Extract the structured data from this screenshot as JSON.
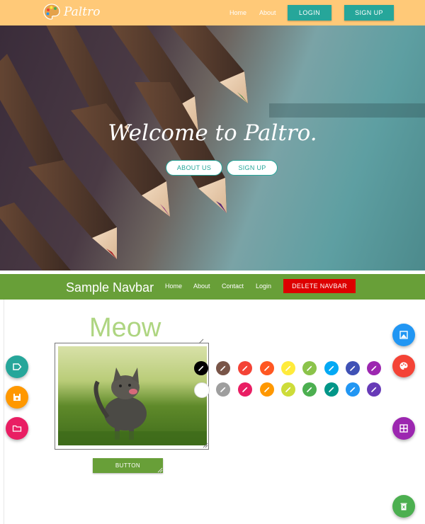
{
  "topbar": {
    "logo_text": "Paltro",
    "links": [
      "Home",
      "About"
    ],
    "login_label": "LOGIN",
    "signup_label": "SIGN UP"
  },
  "hero": {
    "title": "Welcome to Paltro.",
    "about_label": "ABOUT US",
    "signup_label": "SIGN UP"
  },
  "navbar": {
    "brand": "Sample Navbar",
    "links": [
      "Home",
      "About",
      "Contact",
      "Login"
    ],
    "delete_label": "DELETE NAVBAR"
  },
  "canvas": {
    "heading": "Meow",
    "button_label": "BUTTON"
  },
  "palette": {
    "row1": [
      "#000000",
      "#795548",
      "#F44336",
      "#FF5722",
      "#FFEB3B",
      "#8BC34A",
      "#03A9F4",
      "#3F51B5",
      "#9C27B0"
    ],
    "row2": [
      "#FFFFFF",
      "#9E9E9E",
      "#E91E63",
      "#FF9800",
      "#CDDC39",
      "#4CAF50",
      "#009688",
      "#2196F3",
      "#673AB7"
    ]
  },
  "colors": {
    "topbar": "#FFC978",
    "teal": "#26A69A",
    "navbar_green": "#689F38",
    "delete_red": "#DD0000"
  },
  "fabs": {
    "left": [
      {
        "name": "label-icon",
        "color": "#26A69A"
      },
      {
        "name": "save-icon",
        "color": "#FF9800"
      },
      {
        "name": "folder-icon",
        "color": "#E91E63"
      }
    ],
    "right": [
      {
        "name": "image-icon",
        "color": "#2196F3"
      },
      {
        "name": "palette-icon",
        "color": "#F44336"
      },
      {
        "name": "grid-icon",
        "color": "#9C27B0"
      },
      {
        "name": "trash-icon",
        "color": "#4CAF50"
      }
    ]
  }
}
